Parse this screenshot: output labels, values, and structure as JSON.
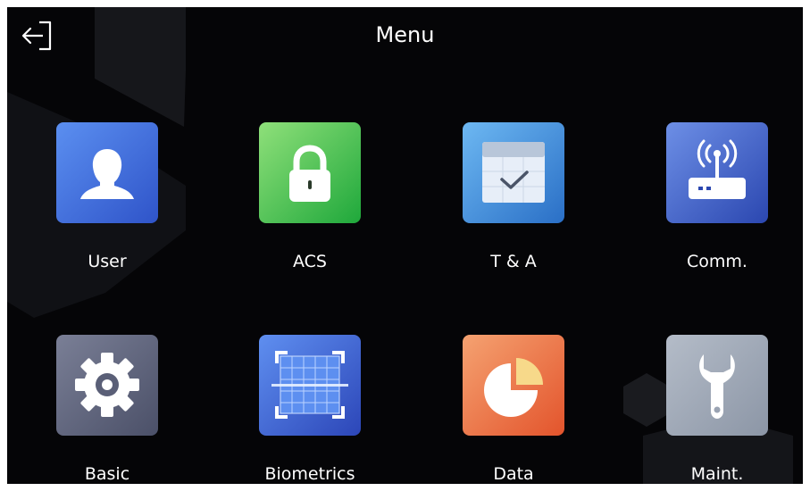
{
  "header": {
    "title": "Menu",
    "back_icon": "exit-icon"
  },
  "menu": {
    "items": [
      {
        "label": "User",
        "icon": "user-icon",
        "colors": [
          "#5b8ff0",
          "#2f54c9"
        ]
      },
      {
        "label": "ACS",
        "icon": "lock-icon",
        "colors": [
          "#8fe07a",
          "#1fa83b"
        ]
      },
      {
        "label": "T & A",
        "icon": "calendar-check-icon",
        "colors": [
          "#6db8f2",
          "#2a6fc6"
        ]
      },
      {
        "label": "Comm.",
        "icon": "router-icon",
        "colors": [
          "#6d8fe6",
          "#2b47b0"
        ]
      },
      {
        "label": "Basic",
        "icon": "gear-icon",
        "colors": [
          "#7a7f96",
          "#4b5068"
        ]
      },
      {
        "label": "Biometrics",
        "icon": "face-scan-icon",
        "colors": [
          "#5f8ff0",
          "#2c46b8"
        ]
      },
      {
        "label": "Data",
        "icon": "pie-chart-icon",
        "colors": [
          "#f5a271",
          "#e3542c"
        ]
      },
      {
        "label": "Maint.",
        "icon": "wrench-icon",
        "colors": [
          "#b4bcc8",
          "#8c96a6"
        ]
      }
    ]
  }
}
